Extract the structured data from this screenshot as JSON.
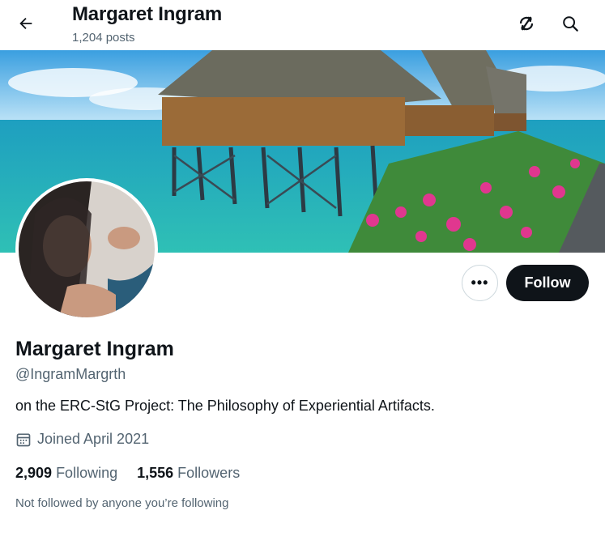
{
  "header": {
    "title": "Margaret Ingram",
    "post_count": "1,204 posts"
  },
  "actions": {
    "more_label": "•••",
    "follow_label": "Follow"
  },
  "profile": {
    "name": "Margaret Ingram",
    "handle": "@IngramMargrth",
    "bio": "on the ERC-StG Project: The Philosophy of Experiential Artifacts.",
    "joined": "Joined April 2021"
  },
  "stats": {
    "following_count": "2,909",
    "following_label": "Following",
    "followers_count": "1,556",
    "followers_label": "Followers"
  },
  "notice": "Not followed by anyone you’re following",
  "icons": {
    "back": "back-arrow-icon",
    "sync": "sync-icon",
    "search": "search-icon",
    "calendar": "calendar-icon"
  },
  "colors": {
    "text_primary": "#0f1419",
    "text_secondary": "#536471",
    "follow_bg": "#0f1419",
    "border": "#cfd9de"
  }
}
